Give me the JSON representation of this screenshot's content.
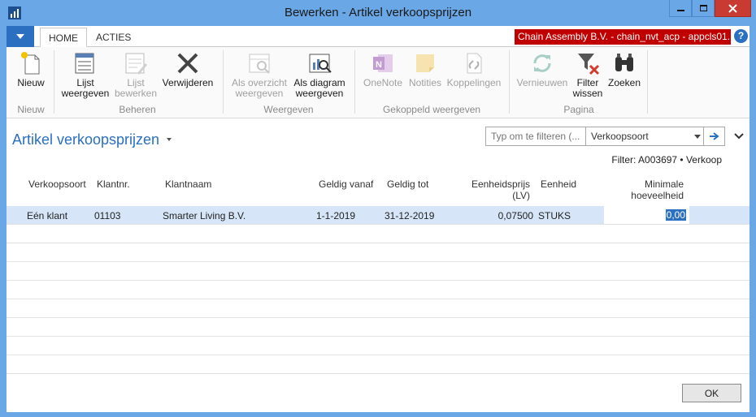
{
  "window": {
    "title": "Bewerken - Artikel verkoopsprijzen"
  },
  "tabs": {
    "home": "HOME",
    "acties": "ACTIES"
  },
  "company_banner": "Chain Assembly B.V. - chain_nvt_acp - appcls01....",
  "help_label": "?",
  "ribbon": {
    "groups": {
      "nieuw": "Nieuw",
      "beheren": "Beheren",
      "weergeven": "Weergeven",
      "gekoppeld": "Gekoppeld weergeven",
      "pagina": "Pagina"
    },
    "buttons": {
      "nieuw": [
        "Nieuw"
      ],
      "lijst_weergeven": [
        "Lijst",
        "weergeven"
      ],
      "lijst_bewerken": [
        "Lijst",
        "bewerken"
      ],
      "verwijderen": [
        "Verwijderen"
      ],
      "als_overzicht": [
        "Als overzicht",
        "weergeven"
      ],
      "als_diagram": [
        "Als diagram",
        "weergeven"
      ],
      "onenote": [
        "OneNote"
      ],
      "notities": [
        "Notities"
      ],
      "koppelingen": [
        "Koppelingen"
      ],
      "vernieuwen": [
        "Vernieuwen"
      ],
      "filter_wissen": [
        "Filter",
        "wissen"
      ],
      "zoeken": [
        "Zoeken"
      ]
    }
  },
  "page": {
    "title": "Artikel verkoopsprijzen",
    "filter": {
      "placeholder": "Typ om te filteren (...",
      "field": "Verkoopsoort",
      "summary": "Filter: A003697 • Verkoop"
    }
  },
  "table": {
    "headers": {
      "verkoopsoort": "Verkoopsoort",
      "klantnr": "Klantnr.",
      "klantnaam": "Klantnaam",
      "geldig_vanaf": "Geldig vanaf",
      "geldig_tot": "Geldig tot",
      "eenheidsprijs": [
        "Eenheidsprijs",
        "(LV)"
      ],
      "eenheid": "Eenheid",
      "minimale": [
        "Minimale",
        "hoeveelheid"
      ]
    },
    "rows": [
      {
        "verkoopsoort": "Eén klant",
        "klantnr": "01103",
        "klantnaam": "Smarter Living B.V.",
        "geldig_vanaf": "1-1-2019",
        "geldig_tot": "31-12-2019",
        "eenheidsprijs": "0,07500",
        "eenheid": "STUKS",
        "minimale": "0,00"
      }
    ]
  },
  "footer": {
    "ok": "OK"
  },
  "colors": {
    "titlebar": "#6aa7e6",
    "accent": "#2a6fc0",
    "company_banner": "#c00000",
    "close_button": "#c83a32",
    "selected_row": "#d6e6f8"
  }
}
